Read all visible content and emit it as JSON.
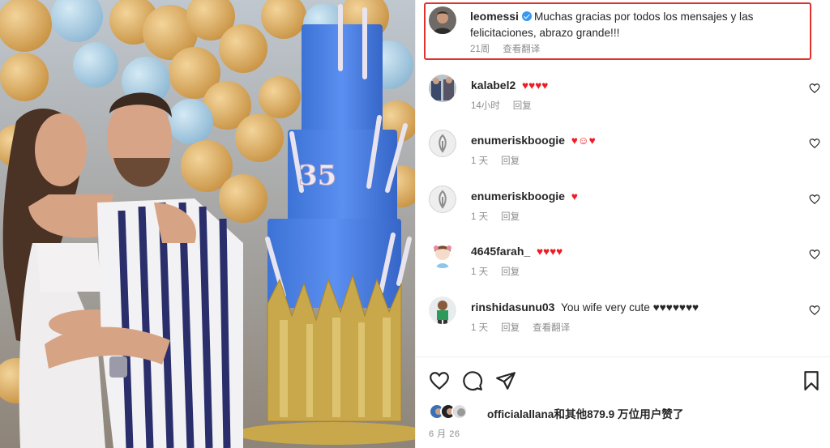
{
  "photo": {
    "cake_number": "35",
    "description_icon": "party-photo"
  },
  "caption": {
    "username": "leomessi",
    "text": "Muchas gracias por todos los mensajes y las felicitaciones, abrazo grande!!!",
    "time": "21周",
    "translate": "查看翻译"
  },
  "comments": [
    {
      "username": "kalabel2",
      "text": "♥♥♥♥",
      "time": "14小时",
      "reply": "回复"
    },
    {
      "username": "enumeriskboogie",
      "text": "♥☺♥",
      "time": "1 天",
      "reply": "回复"
    },
    {
      "username": "enumeriskboogie",
      "text": "♥",
      "time": "1 天",
      "reply": "回复"
    },
    {
      "username": "4645farah_",
      "text": "♥♥♥♥",
      "time": "1 天",
      "reply": "回复"
    },
    {
      "username": "rinshidasunu03",
      "text": "You wife very cute",
      "text_hearts": "♥♥♥♥♥♥♥",
      "time": "1 天",
      "reply": "回复",
      "translate": "查看翻译"
    }
  ],
  "likes": {
    "first_user": "officialallana",
    "rest": "和其他879.9 万位用户赞了"
  },
  "date": "6 月 26",
  "colors": {
    "highlight_border": "#e0312b",
    "verified": "#3897f0",
    "heart": "#ed1c24",
    "muted": "#8e8e8e"
  },
  "icons": [
    "like-icon",
    "comment-icon",
    "share-icon",
    "save-icon",
    "verified-badge-icon"
  ]
}
